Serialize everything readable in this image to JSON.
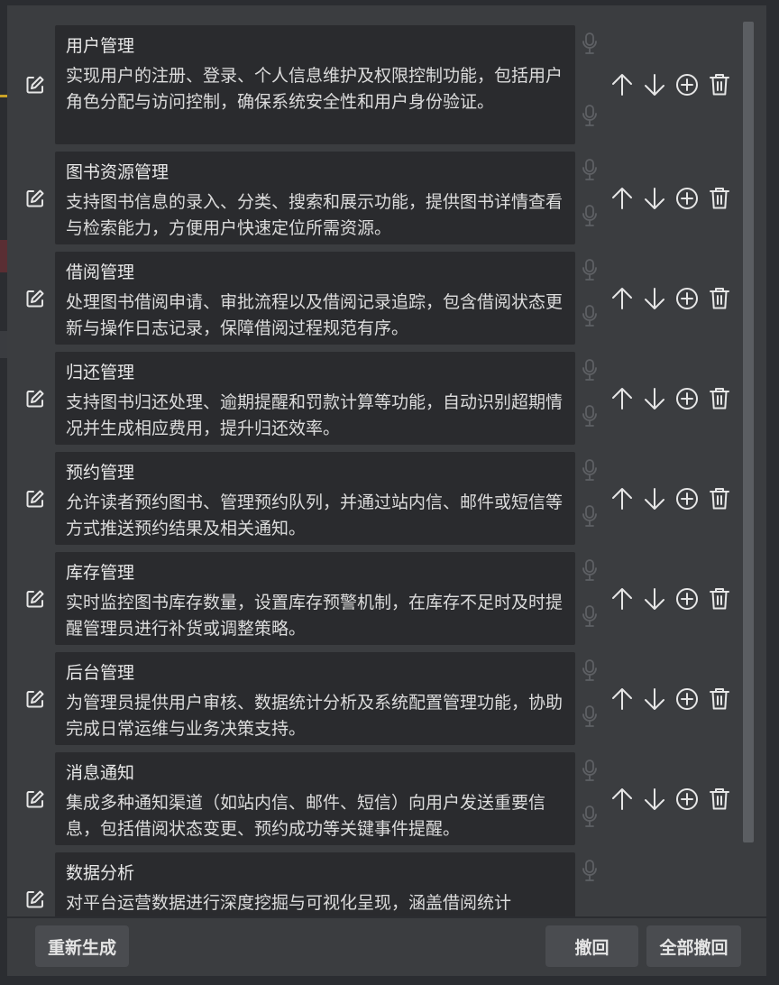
{
  "items": [
    {
      "title": "用户管理",
      "desc": "实现用户的注册、登录、个人信息维护及权限控制功能，包括用户角色分配与访问控制，确保系统安全性和用户身份验证。"
    },
    {
      "title": "图书资源管理",
      "desc": "支持图书信息的录入、分类、搜索和展示功能，提供图书详情查看与检索能力，方便用户快速定位所需资源。"
    },
    {
      "title": "借阅管理",
      "desc": "处理图书借阅申请、审批流程以及借阅记录追踪，包含借阅状态更新与操作日志记录，保障借阅过程规范有序。"
    },
    {
      "title": "归还管理",
      "desc": "支持图书归还处理、逾期提醒和罚款计算等功能，自动识别超期情况并生成相应费用，提升归还效率。"
    },
    {
      "title": "预约管理",
      "desc": "允许读者预约图书、管理预约队列，并通过站内信、邮件或短信等方式推送预约结果及相关通知。"
    },
    {
      "title": "库存管理",
      "desc": "实时监控图书库存数量，设置库存预警机制，在库存不足时及时提醒管理员进行补货或调整策略。"
    },
    {
      "title": "后台管理",
      "desc": "为管理员提供用户审核、数据统计分析及系统配置管理功能，协助完成日常运维与业务决策支持。"
    },
    {
      "title": "消息通知",
      "desc": "集成多种通知渠道（如站内信、邮件、短信）向用户发送重要信息，包括借阅状态变更、预约成功等关键事件提醒。"
    },
    {
      "title": "数据分析",
      "desc": "对平台运营数据进行深度挖掘与可视化呈现，涵盖借阅统计"
    }
  ],
  "footer": {
    "regenerate": "重新生成",
    "undo": "撤回",
    "undo_all": "全部撤回"
  },
  "icons": [
    "edit-icon",
    "mic-icon",
    "arrow-up-icon",
    "arrow-down-icon",
    "plus-circle-icon",
    "trash-icon"
  ],
  "colors": {
    "background": "#2b2d31",
    "panel": "#3b3d40",
    "card": "#2a2b2e",
    "text": "#e6e6e6"
  }
}
